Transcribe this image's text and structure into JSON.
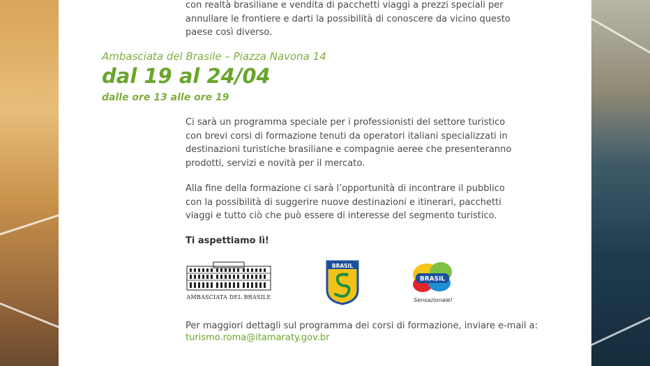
{
  "intro_paragraph": "con realtà brasiliane e vendita di pacchetti viaggi a prezzi speciali per annullare le frontiere e darti la possibilità di conoscere da vicino questo paese così diverso.",
  "event": {
    "location": "Ambasciata del Brasile – Piazza Navona 14",
    "dates": "dal 19 al 24/04",
    "hours": "dalle ore 13 alle ore 19"
  },
  "paragraphs": [
    "Ci sarà un programma speciale per i professionisti del settore turistico con brevi corsi di formazione tenuti da operatori italiani specializzati in destinazioni turistiche brasiliane e compagnie aeree che presenteranno prodotti, servizi e novità per il mercato.",
    "Alla fine della formazione ci sarà l’opportunità di incontrare il pubblico con la possibilità di suggerire nuove destinazioni e itinerari, pacchetti viaggi e tutto ciò che può essere di interesse del segmento turistico."
  ],
  "cta": "Ti aspettiamo lì!",
  "logos": {
    "embassy_caption": "AMBASCIATA DEL BRASILE",
    "shield_text": "BRASIL",
    "brand_text": "BRASIL",
    "brand_tagline": "Sensazionale!"
  },
  "contact": {
    "text": "Per maggiori dettagli sul programma dei corsi di formazione, inviare e-mail a:",
    "email": "turismo.roma@itamaraty.gov.br"
  },
  "colors": {
    "accent_green": "#6aa52b",
    "body_text": "#4a4a4a"
  }
}
